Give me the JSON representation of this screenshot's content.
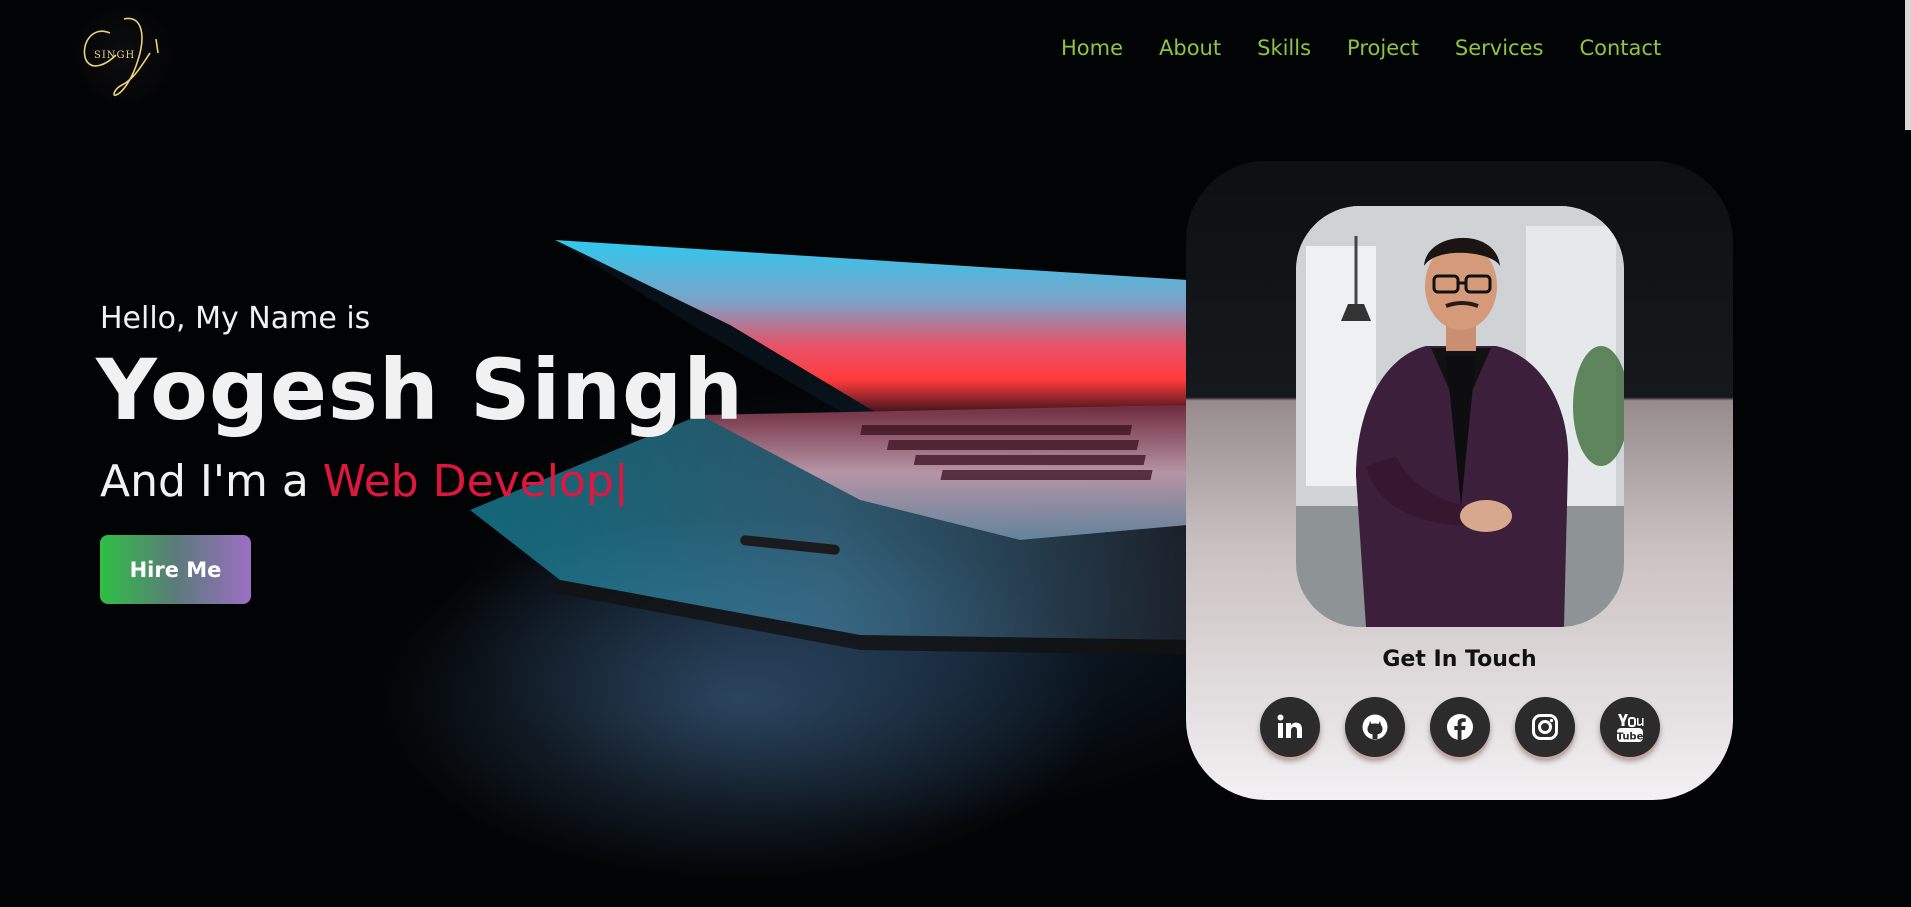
{
  "header": {
    "logo_text": "SINGH",
    "nav": [
      {
        "label": "Home"
      },
      {
        "label": "About"
      },
      {
        "label": "Skills"
      },
      {
        "label": "Project"
      },
      {
        "label": "Services"
      },
      {
        "label": "Contact"
      }
    ]
  },
  "hero": {
    "greeting": "Hello, My Name is",
    "name": "Yogesh Singh",
    "role_prefix": "And I'm a ",
    "role_typed": "Web Develop",
    "caret": "|",
    "hire_button": "Hire Me"
  },
  "card": {
    "get_in_touch": "Get In Touch",
    "socials": [
      {
        "icon": "linkedin-icon"
      },
      {
        "icon": "github-icon"
      },
      {
        "icon": "facebook-icon"
      },
      {
        "icon": "instagram-icon"
      },
      {
        "icon": "youtube-icon"
      }
    ]
  },
  "colors": {
    "nav": "#8cc63f",
    "accent_red": "#e0163f",
    "hero_text": "#f1f1f1"
  }
}
